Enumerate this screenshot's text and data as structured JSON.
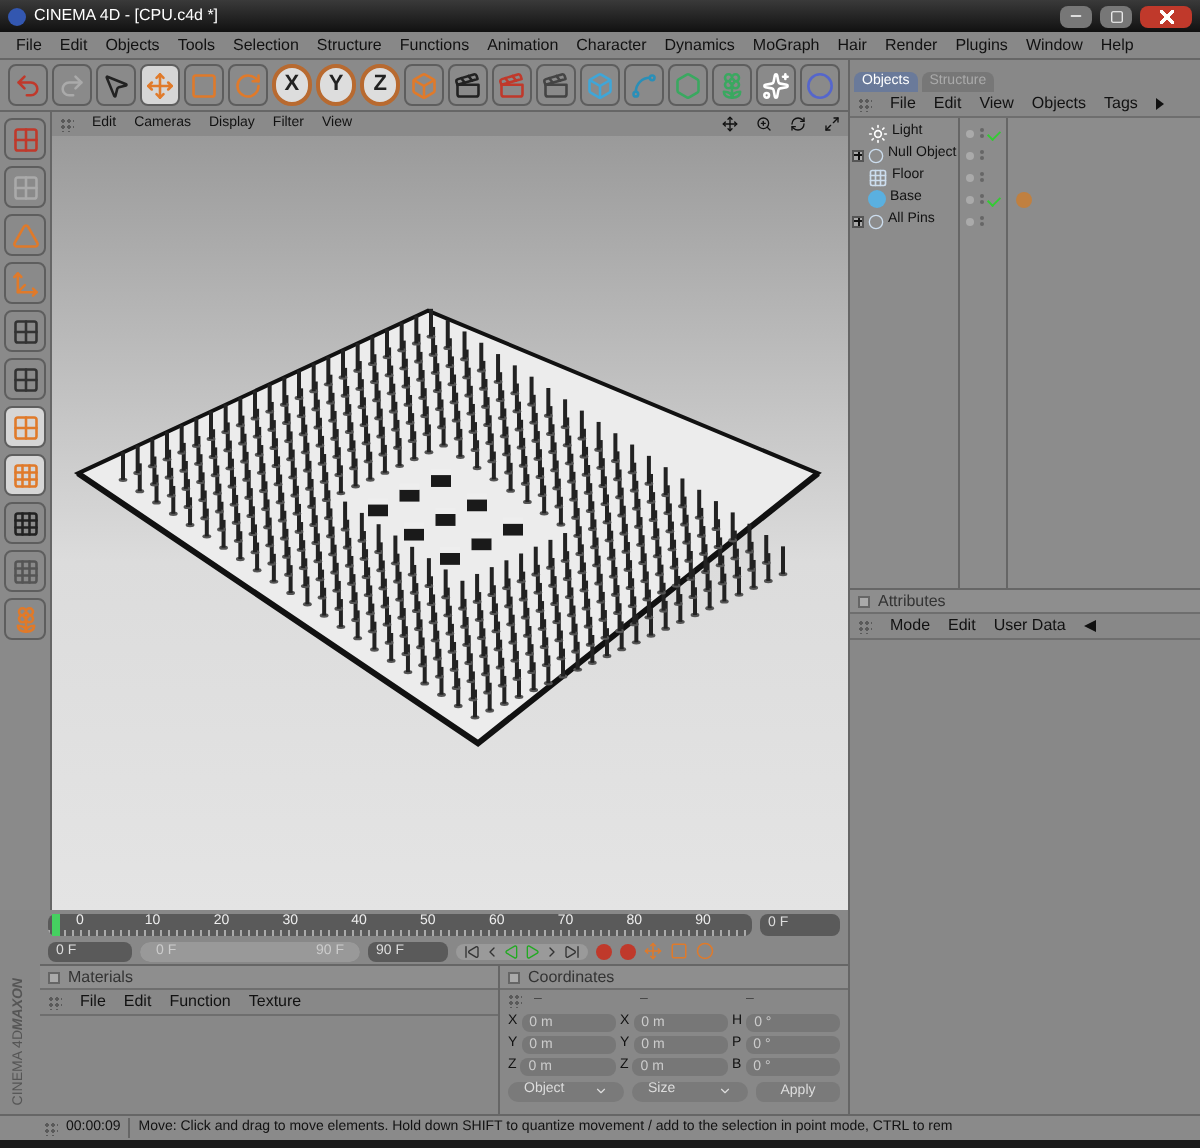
{
  "window": {
    "title": "CINEMA 4D - [CPU.c4d *]"
  },
  "menu": [
    "File",
    "Edit",
    "Objects",
    "Tools",
    "Selection",
    "Structure",
    "Functions",
    "Animation",
    "Character",
    "Dynamics",
    "MoGraph",
    "Hair",
    "Render",
    "Plugins",
    "Window",
    "Help"
  ],
  "toolbar": {
    "axis_buttons": [
      "X",
      "Y",
      "Z"
    ]
  },
  "viewport": {
    "menu": [
      "Edit",
      "Cameras",
      "Display",
      "Filter",
      "View"
    ]
  },
  "objects_panel": {
    "tabs": [
      {
        "label": "Objects",
        "selected": true
      },
      {
        "label": "Structure",
        "selected": false
      }
    ],
    "menu": [
      "File",
      "Edit",
      "View",
      "Objects",
      "Tags"
    ],
    "tree": [
      {
        "name": "Light",
        "kind": "light",
        "checked": true,
        "tag": false
      },
      {
        "name": "Null Object",
        "kind": "null",
        "checked": false,
        "tag": false,
        "expanded": false
      },
      {
        "name": "Floor",
        "kind": "floor",
        "checked": false,
        "tag": false
      },
      {
        "name": "Base",
        "kind": "sphere",
        "checked": true,
        "tag": true
      },
      {
        "name": "All Pins",
        "kind": "null",
        "checked": false,
        "tag": false,
        "expanded": false
      }
    ]
  },
  "attributes_panel": {
    "title": "Attributes",
    "menu": [
      "Mode",
      "Edit",
      "User Data"
    ]
  },
  "timeline": {
    "ticks": [
      "0",
      "10",
      "20",
      "30",
      "40",
      "50",
      "60",
      "70",
      "80",
      "90"
    ],
    "current_frame": "0 F",
    "start": "0 F",
    "range_slider": {
      "start": "0 F",
      "end": "90 F",
      "level": 1
    },
    "end": "90 F"
  },
  "materials_panel": {
    "title": "Materials",
    "menu": [
      "File",
      "Edit",
      "Function",
      "Texture"
    ]
  },
  "coordinates_panel": {
    "title": "Coordinates",
    "headers": [
      "–",
      "–",
      "–"
    ],
    "rows": [
      [
        {
          "label": "X",
          "value": "0 m"
        },
        {
          "label": "X",
          "value": "0 m"
        },
        {
          "label": "H",
          "value": "0 °"
        }
      ],
      [
        {
          "label": "Y",
          "value": "0 m"
        },
        {
          "label": "Y",
          "value": "0 m"
        },
        {
          "label": "P",
          "value": "0 °"
        }
      ],
      [
        {
          "label": "Z",
          "value": "0 m"
        },
        {
          "label": "Z",
          "value": "0 m"
        },
        {
          "label": "B",
          "value": "0 °"
        }
      ]
    ],
    "dropdowns": [
      "Object",
      "Size"
    ],
    "apply": "Apply"
  },
  "logo": {
    "brand": "MAXON",
    "product": "CINEMA 4D"
  },
  "status_bar": {
    "time": "00:00:09",
    "message": "Move: Click and drag to move elements. Hold down SHIFT to quantize movement / add to the selection in point mode, CTRL to rem"
  }
}
